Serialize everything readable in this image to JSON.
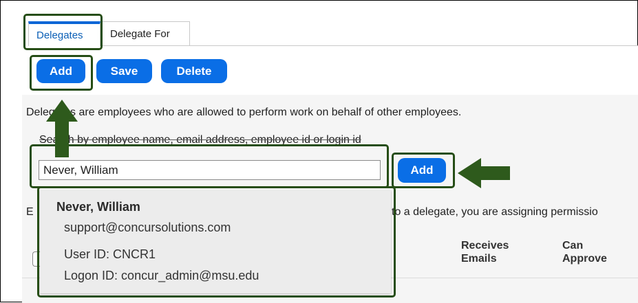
{
  "tabs": [
    {
      "label": "Delegates",
      "active": true
    },
    {
      "label": "Delegate For",
      "active": false
    }
  ],
  "toolbar": {
    "add_label": "Add",
    "save_label": "Save",
    "delete_label": "Delete"
  },
  "description": "Delegates are employees who are allowed to perform work on behalf of other employees.",
  "search": {
    "label": "Search by employee name, email address, employee id or login id",
    "value": "Never, William",
    "add_label": "Add"
  },
  "explain_text": "to a delegate, you are assigning permissio",
  "explain_prefix": "E",
  "columns": {
    "receives_emails": "Receives Emails",
    "can_approve": "Can Approve"
  },
  "suggestion": {
    "name": "Never, William",
    "email": "support@concursolutions.com",
    "user_id": "User ID: CNCR1",
    "logon_id": "Logon ID: concur_admin@msu.edu"
  },
  "colors": {
    "accent": "#0a6ee6",
    "highlight": "#264d16",
    "arrow": "#2e5a1c"
  }
}
